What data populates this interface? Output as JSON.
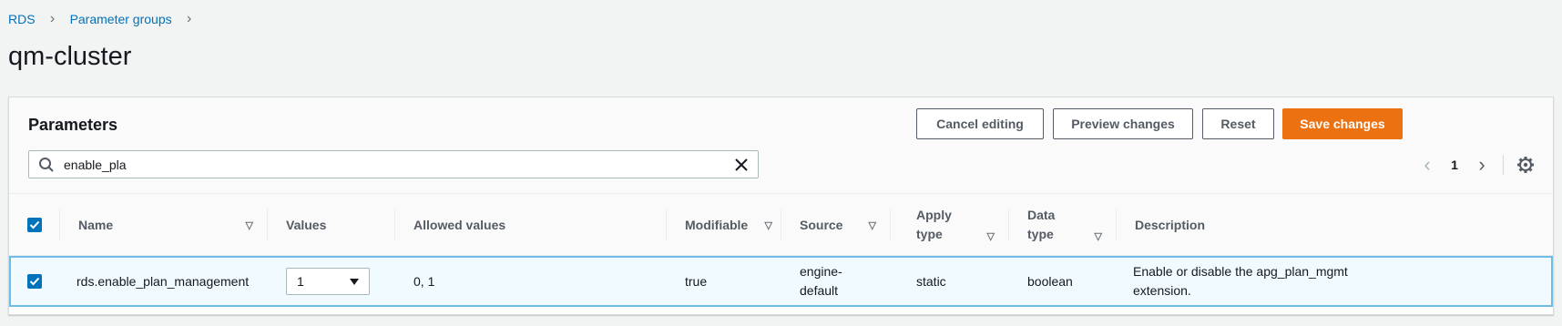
{
  "breadcrumb": {
    "items": [
      "RDS",
      "Parameter groups"
    ]
  },
  "page": {
    "title": "qm-cluster"
  },
  "container": {
    "title": "Parameters",
    "buttons": {
      "cancel": "Cancel editing",
      "preview": "Preview changes",
      "reset": "Reset",
      "save": "Save changes"
    },
    "search": {
      "value": "enable_pla"
    },
    "pagination": {
      "current_page": "1"
    }
  },
  "table": {
    "columns": {
      "name": "Name",
      "values": "Values",
      "allowed_values": "Allowed values",
      "modifiable": "Modifiable",
      "source": "Source",
      "apply_type_1": "Apply",
      "apply_type_2": "type",
      "data_type_1": "Data",
      "data_type_2": "type",
      "description": "Description"
    },
    "rows": [
      {
        "name": "rds.enable_plan_management",
        "value": "1",
        "allowed_values": "0, 1",
        "modifiable": "true",
        "source_1": "engine-",
        "source_2": "default",
        "apply_type": "static",
        "data_type": "boolean",
        "description_1": "Enable or disable the apg_plan_mgmt",
        "description_2": "extension."
      }
    ]
  },
  "colors": {
    "primary": "#ec7211",
    "link": "#0073bb",
    "selected_row_border": "#6fbce5",
    "selected_row_bg": "#f1faff"
  }
}
